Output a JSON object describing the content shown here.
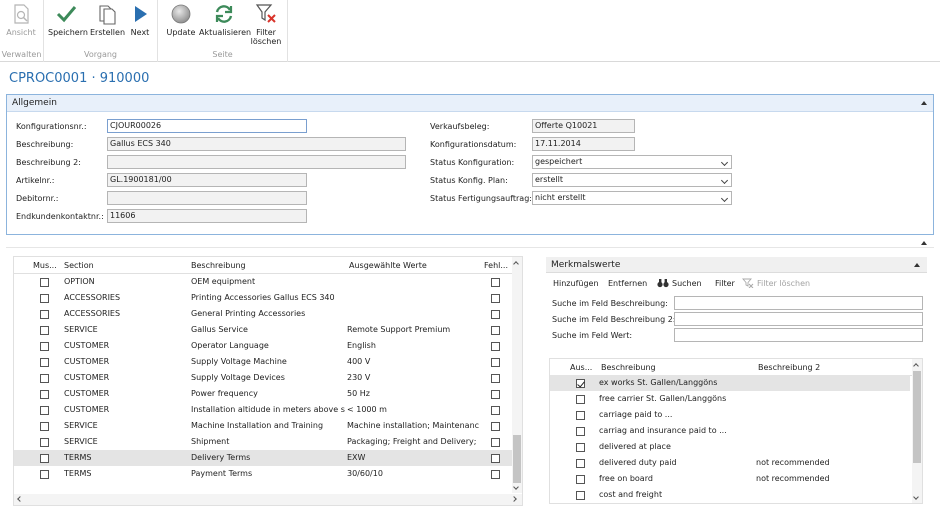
{
  "ribbon": {
    "groups": [
      {
        "label": "Verwalten",
        "buttons": [
          {
            "label": "Ansicht",
            "icon": "document-search-icon",
            "disabled": true
          }
        ]
      },
      {
        "label": "Vorgang",
        "buttons": [
          {
            "label": "Speichern",
            "icon": "checkmark-icon"
          },
          {
            "label": "Erstellen",
            "icon": "documents-icon"
          },
          {
            "label": "Next",
            "icon": "play-arrow-icon"
          }
        ]
      },
      {
        "label": "Seite",
        "buttons": [
          {
            "label": "Update",
            "icon": "circle-icon"
          },
          {
            "label": "Aktualisieren",
            "icon": "refresh-icon"
          },
          {
            "label": "Filter\nlöschen",
            "icon": "filter-clear-icon"
          }
        ]
      }
    ],
    "colors": {
      "check": "#3d8a5a",
      "next": "#2a6fb0",
      "refresh": "#3d8a5a",
      "filter_x": "#d9342b"
    }
  },
  "page_title": "CPROC0001 · 910000",
  "allgemein": {
    "title": "Allgemein",
    "left_fields": [
      {
        "label": "Konfigurationsnr.:",
        "value": "CJOUR00026"
      },
      {
        "label": "Beschreibung:",
        "value": "Gallus ECS 340"
      },
      {
        "label": "Beschreibung 2:",
        "value": ""
      },
      {
        "label": "Artikelnr.:",
        "value": "GL.1900181/00"
      },
      {
        "label": "Debitornr.:",
        "value": ""
      },
      {
        "label": "Endkundenkontaktnr.:",
        "value": "11606"
      }
    ],
    "right_fields": [
      {
        "label": "Verkaufsbeleg:",
        "value": "Offerte Q10021"
      },
      {
        "label": "Konfigurationsdatum:",
        "value": "17.11.2014"
      },
      {
        "label": "Status Konfiguration:",
        "value": "gespeichert"
      },
      {
        "label": "Status Konfig. Plan:",
        "value": "erstellt"
      },
      {
        "label": "Status Fertigungsauftrag:",
        "value": "nicht erstellt"
      }
    ]
  },
  "section_grid": {
    "headers": [
      "Mus...",
      "Section",
      "Beschreibung",
      "Ausgewählte Werte",
      "Fehl..."
    ],
    "rows": [
      {
        "section": "OPTION",
        "beschreibung": "OEM equipment",
        "werte": "",
        "hl": false
      },
      {
        "section": "ACCESSORIES",
        "beschreibung": "Printing Accessories Gallus ECS 340",
        "werte": "",
        "hl": false
      },
      {
        "section": "ACCESSORIES",
        "beschreibung": "General Printing Accessories",
        "werte": "",
        "hl": false
      },
      {
        "section": "SERVICE",
        "beschreibung": "Gallus Service",
        "werte": "Remote Support Premium",
        "hl": false
      },
      {
        "section": "CUSTOMER",
        "beschreibung": "Operator Language",
        "werte": "English",
        "hl": false
      },
      {
        "section": "CUSTOMER",
        "beschreibung": "Supply Voltage Machine",
        "werte": "400 V",
        "hl": false
      },
      {
        "section": "CUSTOMER",
        "beschreibung": "Supply Voltage Devices",
        "werte": "230 V",
        "hl": false
      },
      {
        "section": "CUSTOMER",
        "beschreibung": "Power frequency",
        "werte": "50 Hz",
        "hl": false
      },
      {
        "section": "CUSTOMER",
        "beschreibung": "Installation altidude in meters above se...",
        "werte": "< 1000 m",
        "hl": false
      },
      {
        "section": "SERVICE",
        "beschreibung": "Machine Installation and Training",
        "werte": "Machine installation; Maintenanc...",
        "hl": false
      },
      {
        "section": "SERVICE",
        "beschreibung": "Shipment",
        "werte": "Packaging; Freight and Delivery; ...",
        "hl": false
      },
      {
        "section": "TERMS",
        "beschreibung": "Delivery Terms",
        "werte": "EXW",
        "hl": true
      },
      {
        "section": "TERMS",
        "beschreibung": "Payment Terms",
        "werte": "30/60/10",
        "hl": false
      }
    ]
  },
  "merkmalswerte": {
    "title": "Merkmalswerte",
    "toolbar": {
      "add": "Hinzufügen",
      "remove": "Entfernen",
      "search": "Suchen",
      "filter": "Filter",
      "clear_filter": "Filter löschen"
    },
    "search_fields": [
      {
        "label": "Suche im Feld Beschreibung:",
        "value": ""
      },
      {
        "label": "Suche im Feld Beschreibung 2:",
        "value": ""
      },
      {
        "label": "Suche im Feld Wert:",
        "value": ""
      }
    ],
    "headers": [
      "Aus...",
      "Beschreibung",
      "Beschreibung 2"
    ],
    "rows": [
      {
        "checked": true,
        "beschreibung": "ex works St. Gallen/Langgöns",
        "beschreibung2": "",
        "hl": true
      },
      {
        "checked": false,
        "beschreibung": "free carrier St. Gallen/Langgöns",
        "beschreibung2": "",
        "hl": false
      },
      {
        "checked": false,
        "beschreibung": "carriage paid to ...",
        "beschreibung2": "",
        "hl": false
      },
      {
        "checked": false,
        "beschreibung": "carriag and insurance paid to ...",
        "beschreibung2": "",
        "hl": false
      },
      {
        "checked": false,
        "beschreibung": "delivered at place",
        "beschreibung2": "",
        "hl": false
      },
      {
        "checked": false,
        "beschreibung": "delivered duty paid",
        "beschreibung2": "not recommended",
        "hl": false
      },
      {
        "checked": false,
        "beschreibung": "free on board",
        "beschreibung2": "not recommended",
        "hl": false
      },
      {
        "checked": false,
        "beschreibung": "cost and freight",
        "beschreibung2": "",
        "hl": false
      }
    ]
  }
}
